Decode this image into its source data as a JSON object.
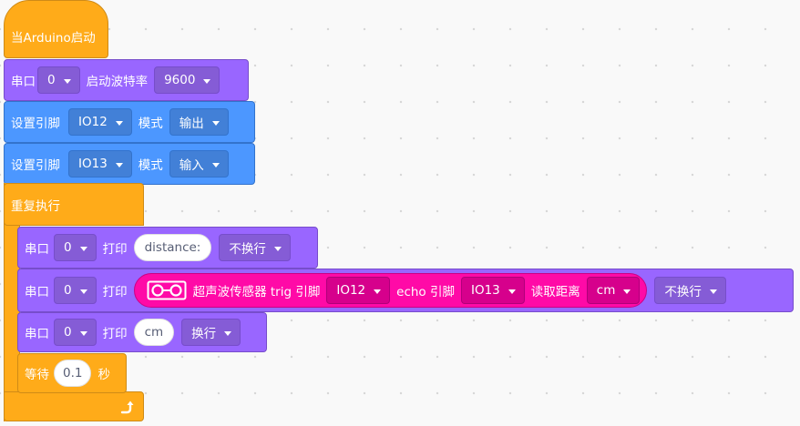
{
  "hat": {
    "label": "当Arduino启动"
  },
  "serial_begin": {
    "label": "串口",
    "port": "0",
    "baud_label": "启动波特率",
    "baud": "9600"
  },
  "pinmode_1": {
    "label": "设置引脚",
    "pin": "IO12",
    "mode_label": "模式",
    "mode": "输出"
  },
  "pinmode_2": {
    "label": "设置引脚",
    "pin": "IO13",
    "mode_label": "模式",
    "mode": "输入"
  },
  "forever": {
    "label": "重复执行"
  },
  "print_1": {
    "label": "串口",
    "port": "0",
    "print_label": "打印",
    "text": "distance:",
    "newline": "不换行"
  },
  "print_2": {
    "label": "串口",
    "port": "0",
    "print_label": "打印",
    "sensor": {
      "icon": "ultrasonic-sensor-icon",
      "title": "超声波传感器 trig 引脚",
      "trig_pin": "IO12",
      "echo_label": "echo 引脚",
      "echo_pin": "IO13",
      "read_label": "读取距离",
      "unit": "cm"
    },
    "newline": "不换行"
  },
  "print_3": {
    "label": "串口",
    "port": "0",
    "print_label": "打印",
    "text": "cm",
    "newline": "换行"
  },
  "wait": {
    "label": "等待",
    "seconds": "0.1",
    "unit": "秒"
  },
  "loop_icon": "repeat-arrow-icon",
  "colors": {
    "control": "#ffab19",
    "serial": "#9966ff",
    "pin": "#4c97ff",
    "sensor": "#ff0aa7",
    "canvas": "#f9f9f9"
  }
}
